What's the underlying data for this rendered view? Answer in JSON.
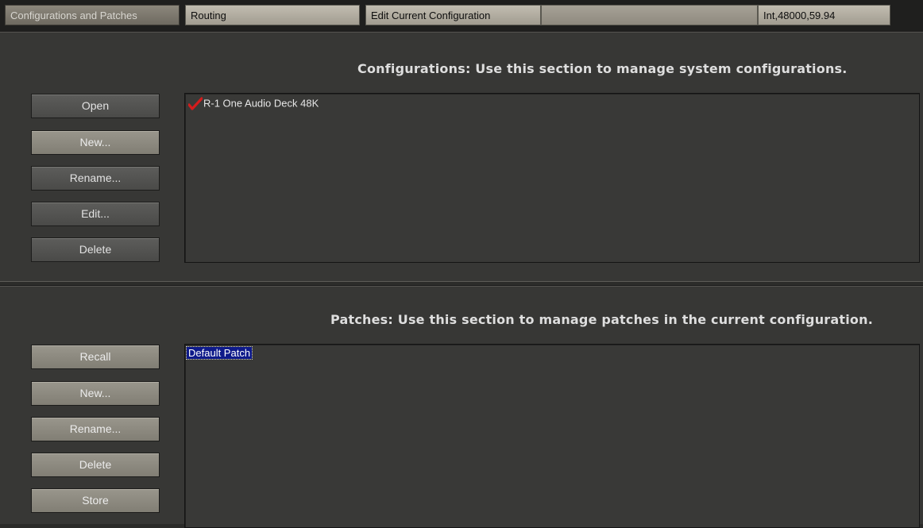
{
  "tabs": [
    {
      "label": "Configurations and Patches",
      "active": true
    },
    {
      "label": "Routing",
      "active": false
    },
    {
      "label": "Edit Current Configuration",
      "active": false
    },
    {
      "label": "",
      "active": false
    },
    {
      "label": "Int,48000,59.94",
      "active": false
    }
  ],
  "configurations": {
    "title": "Configurations:  Use this section to manage system configurations.",
    "buttons": {
      "open": "Open",
      "new": "New...",
      "rename": "Rename...",
      "edit": "Edit...",
      "delete": "Delete"
    },
    "items": [
      {
        "label": "R-1 One Audio Deck 48K",
        "icon": "checkmark-icon",
        "current": true
      }
    ]
  },
  "patches": {
    "title": "Patches:  Use this section to manage patches in the current configuration.",
    "buttons": {
      "recall": "Recall",
      "new": "New...",
      "rename": "Rename...",
      "delete": "Delete",
      "store": "Store"
    },
    "items": [
      {
        "label": "Default Patch",
        "selected": true
      }
    ]
  },
  "colors": {
    "background": "#373735",
    "selection": "#0e1a8a",
    "check": "#d41c1c"
  }
}
